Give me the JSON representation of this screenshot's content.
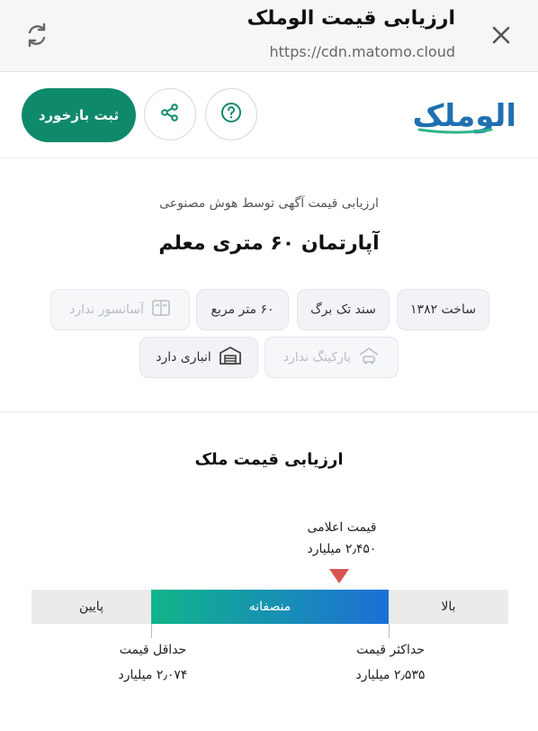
{
  "chrome": {
    "title": "ارزیابی قیمت الوملک",
    "url": "https://cdn.matomo.cloud",
    "refresh_icon": "refresh-icon",
    "close_icon": "close-icon"
  },
  "header": {
    "register_label": "ثبت بازخورد",
    "share_icon": "share-icon",
    "help_icon": "question-circle-icon",
    "logo_text": "الوملک",
    "colors": {
      "brand_green": "#0e8a6b",
      "logo_blue": "#1f6fb2",
      "logo_green": "#2fb38a"
    }
  },
  "listing": {
    "subtitle": "ارزیابی قیمت آگهی توسط هوش مصنوعی",
    "title": "آپارتمان ۶۰ متری معلم",
    "features": [
      {
        "label": "ساخت ۱۳۸۲",
        "enabled": true
      },
      {
        "label": "سند تک برگ",
        "enabled": true
      },
      {
        "label": "۶۰ متر مربع",
        "enabled": true
      },
      {
        "label": "آسانسور ندارد",
        "enabled": false,
        "icon": "elevator-icon"
      },
      {
        "label": "پارکینگ ندارد",
        "enabled": false,
        "icon": "parking-icon"
      },
      {
        "label": "انباری دارد",
        "enabled": true,
        "icon": "storage-icon"
      }
    ]
  },
  "valuation": {
    "title": "ارزیابی قیمت ملک",
    "announced_label": "قیمت اعلامی",
    "announced_value": "۲٫۴۵۰ میلیارد",
    "bands": {
      "low": "پایین",
      "fair": "منصفانه",
      "high": "بالا"
    },
    "min_label": "حداقل قیمت",
    "min_value": "۲٫۰۷۴ میلیارد",
    "max_label": "حداکثر قیمت",
    "max_value": "۲٫۵۳۵ میلیارد",
    "colors": {
      "gradient_start": "#10b58a",
      "gradient_end": "#1d6fd7",
      "marker": "#d9534f"
    }
  }
}
